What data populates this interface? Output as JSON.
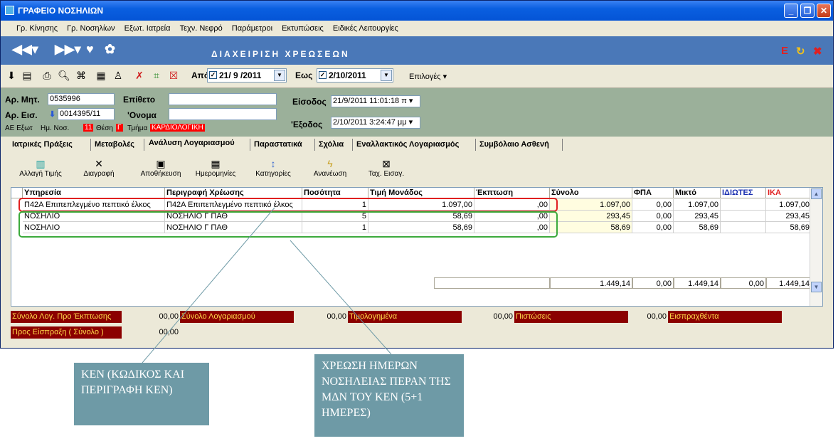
{
  "window": {
    "title": "ΓΡΑΦΕΙΟ ΝΟΣΗΛΙΩΝ"
  },
  "menu": [
    "Γρ. Κίνησης",
    "Γρ. Νοσηλίων",
    "Εξωτ. Ιατρεία",
    "Τεχν. Νεφρό",
    "Παράμετροι",
    "Εκτυπώσεις",
    "Ειδικές Λειτουργίες"
  ],
  "nav": {
    "title": "ΔΙΑΧΕΙΡΙΣΗ ΧΡΕΩΣΕΩΝ",
    "e_mark": "E"
  },
  "filters": {
    "from_label": "Από",
    "from_date": "21/ 9 /2011",
    "to_label": "Εως",
    "to_date": "2/10/2011",
    "options_label": "Επιλογές"
  },
  "patient": {
    "ar_mit_label": "Αρ. Μητ.",
    "ar_mit": "0535996",
    "epitheto_label": "Επίθετο",
    "epitheto": "",
    "ar_eis_label": "Αρ. Εισ.",
    "ar_eis": "0014395/11",
    "onoma_label": "'Ονομα",
    "onoma": "",
    "ae_label": "ΑΕ Εξωτ",
    "im_nos_label": "Ημ. Νοσ.",
    "im_nos": "11",
    "thesi_label": "Θέση",
    "thesi": "Γ",
    "tmima_label": "Τμήμα",
    "tmima": "ΚΑΡΔΙΟΛΟΓΙΚΗ",
    "eisodos_label": "Είσοδος",
    "eisodos": "21/9/2011 11:01:18 π",
    "exodos_label": "'Εξοδος",
    "exodos": "2/10/2011 3:24:47 μμ"
  },
  "tabs": [
    "Ιατρικές Πράξεις",
    "Μεταβολές",
    "Ανάλυση Λογαριασμού",
    "Παραστατικά",
    "Σχόλια",
    "Εναλλακτικός Λογαριασμός",
    "Συμβόλαιο Ασθενή"
  ],
  "subtoolbar": [
    "Αλλαγή Τιμής",
    "Διαγραφή",
    "Αποθήκευση",
    "Ημερομηνίες",
    "Κατηγορίες",
    "Ανανέωση",
    "Ταχ. Εισαγ."
  ],
  "table": {
    "headers": [
      "Υπηρεσία",
      "Περιγραφή Χρέωσης",
      "Ποσότητα",
      "Τιμή Μονάδος",
      "Έκπτωση",
      "Σύνολο",
      "ΦΠΑ",
      "Μικτό",
      "ΙΔΙΩΤΕΣ",
      "ΙΚΑ"
    ],
    "rows": [
      [
        "Π42Α Επιπεπλεγμένο πεπτικό έλκος",
        "Π42Α Επιπεπλεγμένο πεπτικό έλκος",
        "1",
        "1.097,00",
        ",00",
        "1.097,00",
        "0,00",
        "1.097,00",
        "",
        "1.097,00"
      ],
      [
        "ΝΟΣΗΛΙΟ",
        "ΝΟΣΗΛΙΟ Γ ΠΑΘ",
        "5",
        "58,69",
        ",00",
        "293,45",
        "0,00",
        "293,45",
        "",
        "293,45"
      ],
      [
        "ΝΟΣΗΛΙΟ",
        "ΝΟΣΗΛΙΟ Γ ΠΑΘ",
        "1",
        "58,69",
        ",00",
        "58,69",
        "0,00",
        "58,69",
        "",
        "58,69"
      ]
    ],
    "totals": [
      "1.449,14",
      "0,00",
      "1.449,14",
      "0,00",
      "1.449,14"
    ]
  },
  "summary": {
    "synolo_pro_label": "Σύνολο Λογ. Προ Έκπτωσης",
    "synolo_pro": "00,00",
    "synolo_log_label": "Σύνολο Λογαριασμού",
    "synolo_log": "00,00",
    "timologimena_label": "Τιμολογημένα",
    "timologimena": "00,00",
    "pistoseis_label": "Πιστώσεις",
    "pistoseis": "00,00",
    "eispraxthenta_label": "Εισπραχθέντα",
    "pros_eispraxi_label": "Προς Είσπραξη ( Σύνολο )",
    "pros_eispraxi": "00,00"
  },
  "callouts": {
    "ken": "ΚΕΝ (ΚΩΔΙΚΟΣ ΚΑΙ ΠΕΡΙΓΡΑΦΗ ΚΕΝ)",
    "xreosi": "ΧΡΕΩΣΗ ΗΜΕΡΩΝ ΝΟΣΗΛΕΙΑΣ ΠΕΡΑΝ ΤΗΣ ΜΔΝ ΤΟΥ ΚΕΝ (5+1 ΗΜΕΡΕΣ)"
  },
  "colors": {
    "title_bar": "#0454d6",
    "nav_bar": "#4a78b8",
    "patient_panel": "#9bb09a",
    "summary_label_bg": "#8b0000",
    "summary_label_fg": "#ffd84a",
    "callout_bg": "#6e9aa6",
    "red_box": "#e02020",
    "green_box": "#3caa3c"
  }
}
